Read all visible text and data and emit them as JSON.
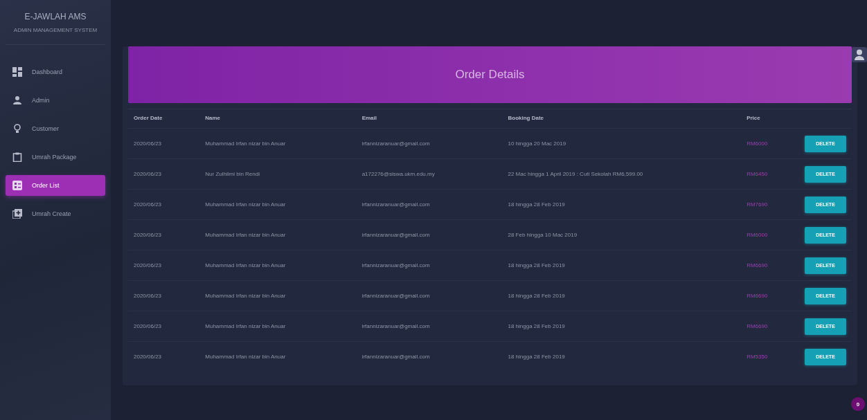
{
  "sidebar": {
    "brand": "E-JAWLAH AMS",
    "subtitle": "ADMIN MANAGEMENT SYSTEM",
    "items": [
      {
        "label": "Dashboard",
        "kind": "grid",
        "selected": false
      },
      {
        "label": "Admin",
        "kind": "person",
        "selected": false
      },
      {
        "label": "Customer",
        "kind": "bulb",
        "selected": false
      },
      {
        "label": "Umrah Package",
        "kind": "clipboard",
        "selected": false
      },
      {
        "label": "Order List",
        "kind": "list",
        "selected": true
      },
      {
        "label": "Umrah Create",
        "kind": "plus",
        "selected": false
      }
    ]
  },
  "card": {
    "title": "Order Details"
  },
  "table": {
    "columns": [
      "Order Date",
      "Name",
      "Email",
      "Booking Date",
      "Price"
    ],
    "rows": [
      {
        "order_date": "2020/06/23",
        "name": "Muhammad Irfan nizar bin Anuar",
        "email": "irfannizaranuar@gmail.com",
        "booking_date": "10 hingga 20 Mac 2019",
        "price": "RM6000",
        "action": "DELETE"
      },
      {
        "order_date": "2020/06/23",
        "name": "Nur Zulhilmi bin Rendi",
        "email": "a172276@siswa.ukm.edu.my",
        "booking_date": "22 Mac hingga 1 April 2019 : Cuti Sekolah RM6,599.00",
        "price": "RM6450",
        "action": "DELETE"
      },
      {
        "order_date": "2020/06/23",
        "name": "Muhammad Irfan nizar bin Anuar",
        "email": "irfannizaranuar@gmail.com",
        "booking_date": "18 hingga 28 Feb 2019",
        "price": "RM7690",
        "action": "DELETE"
      },
      {
        "order_date": "2020/06/23",
        "name": "Muhammad Irfan nizar bin Anuar",
        "email": "irfannizaranuar@gmail.com",
        "booking_date": "28 Feb hingga 10 Mac 2019",
        "price": "RM6000",
        "action": "DELETE"
      },
      {
        "order_date": "2020/06/23",
        "name": "Muhammad Irfan nizar bin Anuar",
        "email": "irfannizaranuar@gmail.com",
        "booking_date": "18 hingga 28 Feb 2019",
        "price": "RM6690",
        "action": "DELETE"
      },
      {
        "order_date": "2020/06/23",
        "name": "Muhammad Irfan nizar bin Anuar",
        "email": "irfannizaranuar@gmail.com",
        "booking_date": "18 hingga 28 Feb 2019",
        "price": "RM6690",
        "action": "DELETE"
      },
      {
        "order_date": "2020/06/23",
        "name": "Muhammad Irfan nizar bin Anuar",
        "email": "irfannizaranuar@gmail.com",
        "booking_date": "18 hingga 28 Feb 2019",
        "price": "RM6690",
        "action": "DELETE"
      },
      {
        "order_date": "2020/06/23",
        "name": "Muhammad Irfan nizar bin Anuar",
        "email": "irfannizaranuar@gmail.com",
        "booking_date": "18 hingga 28 Feb 2019",
        "price": "RM5350",
        "action": "DELETE"
      }
    ]
  },
  "notification_badge": "0"
}
